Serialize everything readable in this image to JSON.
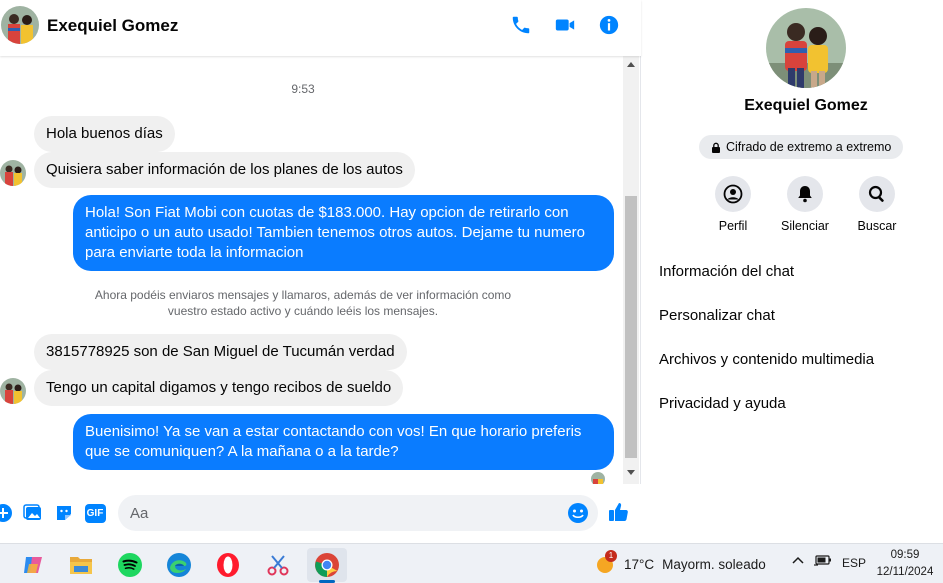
{
  "header": {
    "contact_name": "Exequiel Gomez",
    "icons": [
      "phone-icon",
      "video-camera-icon",
      "info-icon"
    ]
  },
  "conversation": {
    "timestamp": "9:53",
    "messages": [
      {
        "direction": "in",
        "text": "Hola buenos días"
      },
      {
        "direction": "in",
        "text": "Quisiera saber información de los planes de los autos"
      },
      {
        "direction": "out",
        "text": "Hola! Son Fiat Mobi con cuotas de $183.000. Hay opcion de retirarlo con anticipo o un auto usado! Tambien tenemos otros autos. Dejame tu numero para enviarte toda la informacion"
      },
      {
        "direction": "in",
        "text": "3815778925 son de San Miguel de Tucumán verdad"
      },
      {
        "direction": "in",
        "text": "Tengo un capital digamos y tengo recibos de sueldo"
      },
      {
        "direction": "out",
        "text": "Buenisimo! Ya se van a estar contactando con vos! En que horario preferis que se comuniquen? A la mañana o a la tarde?"
      }
    ],
    "system_notice": "Ahora podéis enviaros mensajes y llamaros, además de ver información como vuestro estado activo y cuándo leéis los mensajes."
  },
  "composer": {
    "placeholder": "Aa",
    "icons": [
      "plus-icon",
      "image-icon",
      "sticker-icon",
      "gif-icon",
      "emoji-icon",
      "thumbs-up-icon"
    ],
    "gif_label": "GIF"
  },
  "panel": {
    "name": "Exequiel Gomez",
    "encryption_badge": "Cifrado de extremo a extremo",
    "actions": [
      {
        "label": "Perfil",
        "icon": "profile-icon"
      },
      {
        "label": "Silenciar",
        "icon": "bell-icon"
      },
      {
        "label": "Buscar",
        "icon": "search-icon"
      }
    ],
    "menu": [
      "Información del chat",
      "Personalizar chat",
      "Archivos y contenido multimedia",
      "Privacidad y ayuda"
    ]
  },
  "taskbar": {
    "apps": [
      "copilot-icon",
      "file-explorer-icon",
      "spotify-icon",
      "edge-icon",
      "opera-icon",
      "snipping-tool-icon",
      "chrome-icon"
    ],
    "active_app": "chrome-icon",
    "weather": {
      "temp": "17°C",
      "condition": "Mayorm. soleado",
      "badge": "1"
    },
    "language": "ESP",
    "time": "09:59",
    "date": "12/11/2024"
  },
  "colors": {
    "accent": "#0a7cff",
    "incoming_bubble": "#f0f0f0",
    "messenger_blue": "#0084ff"
  }
}
